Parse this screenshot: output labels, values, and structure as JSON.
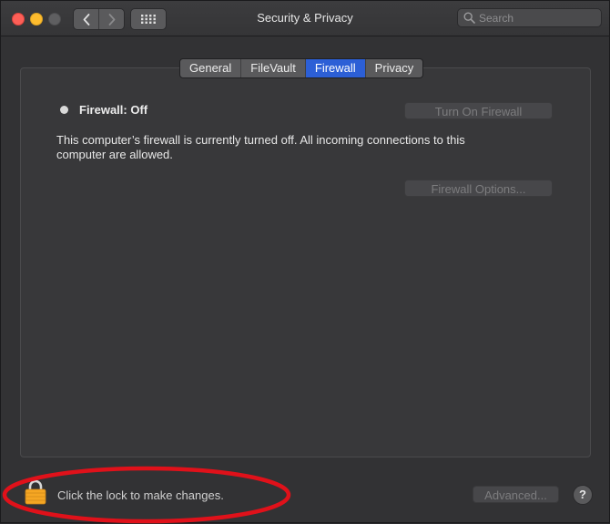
{
  "window": {
    "title": "Security & Privacy"
  },
  "toolbar": {
    "back_icon": "chevron-left-icon",
    "forward_icon": "chevron-right-icon",
    "grid_icon": "grid-icon",
    "search_placeholder": "Search",
    "search_icon": "search-icon"
  },
  "tabs": [
    {
      "label": "General",
      "active": false
    },
    {
      "label": "FileVault",
      "active": false
    },
    {
      "label": "Firewall",
      "active": true
    },
    {
      "label": "Privacy",
      "active": false
    }
  ],
  "firewall": {
    "status_label": "Firewall: Off",
    "turn_on_label": "Turn On Firewall",
    "description": "This computer’s firewall is currently turned off. All incoming connections to this computer are allowed.",
    "options_label": "Firewall Options..."
  },
  "footer": {
    "lock_icon": "lock-icon",
    "lock_text": "Click the lock to make changes.",
    "advanced_label": "Advanced...",
    "help_label": "?"
  },
  "colors": {
    "accent": "#2c5fd6",
    "annotation": "#e0111a",
    "close": "#fd5f57",
    "minimize": "#febc2e",
    "lock": "#f5a623"
  }
}
